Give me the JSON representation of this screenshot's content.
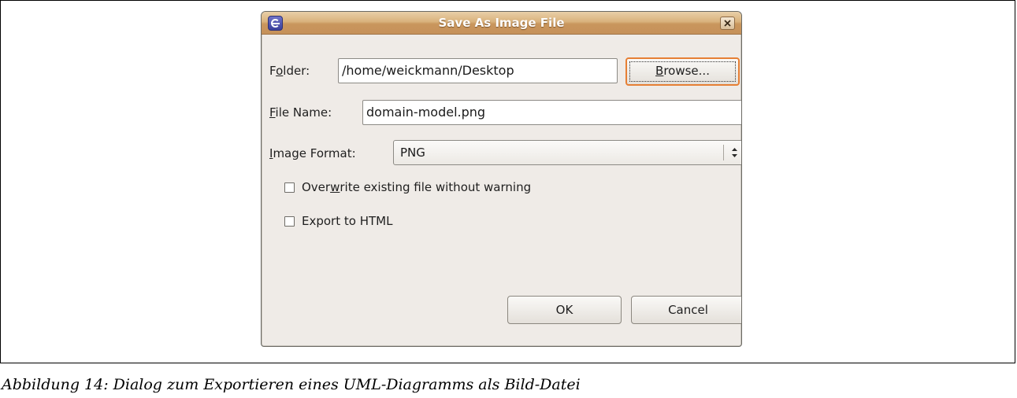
{
  "dialog": {
    "title": "Save As Image File",
    "folder": {
      "label_pre": "F",
      "label_accel": "o",
      "label_post": "lder:",
      "value": "/home/weickmann/Desktop"
    },
    "browse_button": {
      "accel": "B",
      "rest": "rowse..."
    },
    "file_name": {
      "label_accel": "F",
      "label_post": "ile Name:",
      "value": "domain-model.png"
    },
    "image_format": {
      "label_accel": "I",
      "label_post": "mage Format:",
      "selected": "PNG"
    },
    "checkboxes": {
      "overwrite": {
        "label_pre": "Over",
        "label_accel": "w",
        "label_post": "rite existing file without warning",
        "checked": false
      },
      "export_html": {
        "label": "Export to HTML",
        "checked": false
      }
    },
    "ok_label": "OK",
    "cancel_label": "Cancel",
    "icons": {
      "app": "eclipse-icon",
      "close": "close-icon",
      "select": "updown-arrows-icon"
    },
    "colors": {
      "titlebar": "#d9b27c",
      "focus_border": "#e67f34",
      "dialog_bg": "#efebe7"
    }
  },
  "caption": "Abbildung 14: Dialog zum Exportieren eines UML-Diagramms als Bild-Datei"
}
